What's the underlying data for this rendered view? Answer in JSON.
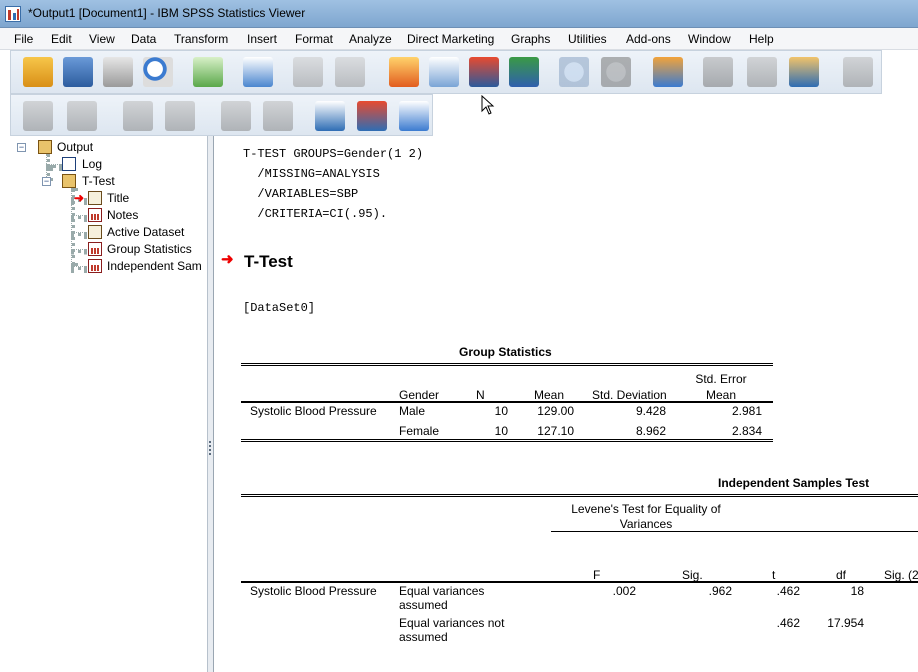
{
  "window": {
    "title": "*Output1 [Document1] - IBM SPSS Statistics Viewer"
  },
  "menu": [
    "File",
    "Edit",
    "View",
    "Data",
    "Transform",
    "Insert",
    "Format",
    "Analyze",
    "Direct Marketing",
    "Graphs",
    "Utilities",
    "Add-ons",
    "Window",
    "Help"
  ],
  "nav": {
    "root": "Output",
    "log": "Log",
    "ttest": "T-Test",
    "items": [
      "Title",
      "Notes",
      "Active Dataset",
      "Group Statistics",
      "Independent Sam"
    ]
  },
  "syntax": [
    "T-TEST GROUPS=Gender(1 2)",
    "  /MISSING=ANALYSIS",
    "  /VARIABLES=SBP",
    "  /CRITERIA=CI(.95)."
  ],
  "heading": "T-Test",
  "dataset": "[DataSet0]",
  "group_stats": {
    "title": "Group Statistics",
    "headers": {
      "gender": "Gender",
      "n": "N",
      "mean": "Mean",
      "sd": "Std. Deviation",
      "se1": "Std. Error",
      "se2": "Mean"
    },
    "variable": "Systolic Blood Pressure",
    "rows": [
      {
        "gender": "Male",
        "n": "10",
        "mean": "129.00",
        "sd": "9.428",
        "se": "2.981"
      },
      {
        "gender": "Female",
        "n": "10",
        "mean": "127.10",
        "sd": "8.962",
        "se": "2.834"
      }
    ]
  },
  "ind_test": {
    "title": "Independent Samples Test",
    "levene1": "Levene's Test for Equality of",
    "levene2": "Variances",
    "headers": {
      "f": "F",
      "sig": "Sig.",
      "t": "t",
      "df": "df",
      "sig2": "Sig. (2"
    },
    "variable": "Systolic Blood Pressure",
    "rows": [
      {
        "label1": "Equal variances",
        "label2": "assumed",
        "f": ".002",
        "sig": ".962",
        "t": ".462",
        "df": "18"
      },
      {
        "label1": "Equal variances not",
        "label2": "assumed",
        "f": "",
        "sig": "",
        "t": ".462",
        "df": "17.954"
      }
    ]
  }
}
